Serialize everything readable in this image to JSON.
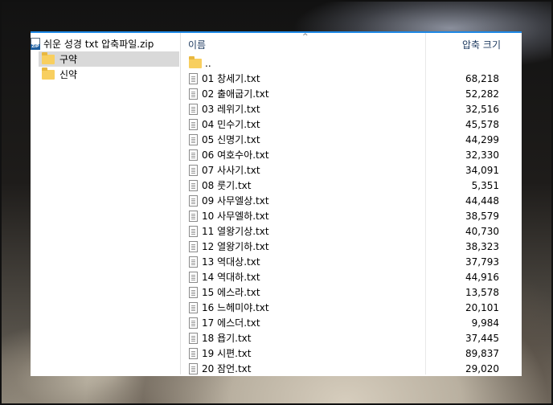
{
  "tree": {
    "root": "쉬운 성경 txt 압축파일.zip",
    "items": [
      {
        "label": "구약",
        "selected": true
      },
      {
        "label": "신약",
        "selected": false
      }
    ]
  },
  "list": {
    "headers": {
      "name": "이름",
      "size": "압축 크기"
    },
    "sort_indicator": "^",
    "parent_entry": "..",
    "rows": [
      {
        "name": "01 창세기.txt",
        "size": "68,218"
      },
      {
        "name": "02 출애굽기.txt",
        "size": "52,282"
      },
      {
        "name": "03 레위기.txt",
        "size": "32,516"
      },
      {
        "name": "04 민수기.txt",
        "size": "45,578"
      },
      {
        "name": "05 신명기.txt",
        "size": "44,299"
      },
      {
        "name": "06 여호수아.txt",
        "size": "32,330"
      },
      {
        "name": "07 사사기.txt",
        "size": "34,091"
      },
      {
        "name": "08 룻기.txt",
        "size": "5,351"
      },
      {
        "name": "09 사무엘상.txt",
        "size": "44,448"
      },
      {
        "name": "10 사무엘하.txt",
        "size": "38,579"
      },
      {
        "name": "11 열왕기상.txt",
        "size": "40,730"
      },
      {
        "name": "12 열왕기하.txt",
        "size": "38,323"
      },
      {
        "name": "13 역대상.txt",
        "size": "37,793"
      },
      {
        "name": "14 역대하.txt",
        "size": "44,916"
      },
      {
        "name": "15 에스라.txt",
        "size": "13,578"
      },
      {
        "name": "16 느헤미야.txt",
        "size": "20,101"
      },
      {
        "name": "17 에스더.txt",
        "size": "9,984"
      },
      {
        "name": "18 욥기.txt",
        "size": "37,445"
      },
      {
        "name": "19 시편.txt",
        "size": "89,837"
      },
      {
        "name": "20 잠언.txt",
        "size": "29,020"
      }
    ]
  },
  "colors": {
    "accent": "#1e88e5",
    "selection": "#d9d9d9",
    "folder": "#f8cf5f"
  }
}
